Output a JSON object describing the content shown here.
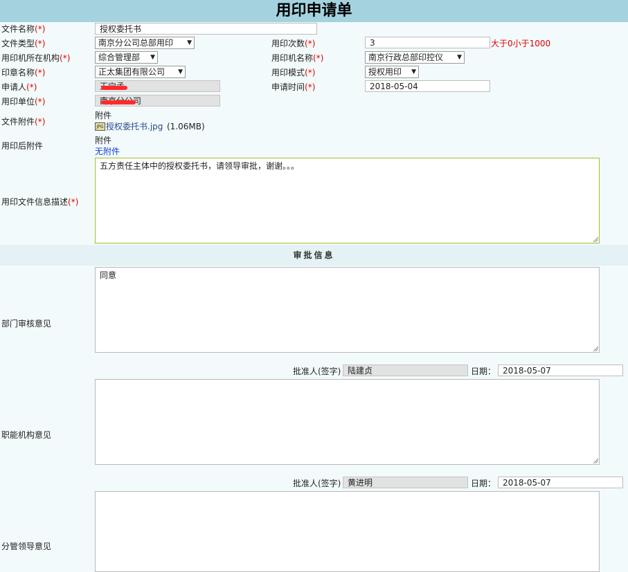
{
  "header": {
    "title": "用印申请单"
  },
  "labels": {
    "file_name": "文件名称",
    "file_type": "文件类型",
    "printer_org": "用印机所在机构",
    "seal_name": "印章名称",
    "applicant": "申请人",
    "unit": "用印单位",
    "attachment": "文件附件",
    "after_attachment": "用印后附件",
    "description": "用印文件信息描述",
    "use_count": "用印次数",
    "printer_name": "用印机名称",
    "mode": "用印模式",
    "apply_time": "申请时间",
    "required": "(*)"
  },
  "form": {
    "file_name_value": "授权委托书",
    "file_type_value": "南京分公司总部用印",
    "use_count_value": "3",
    "use_count_hint": "大于0小于1000",
    "printer_org_value": "综合管理部",
    "printer_name_value": "南京行政总部印控仪",
    "seal_name_value": "正太集团有限公司",
    "mode_value": "授权用印",
    "applicant_value": "王宁孟",
    "apply_time_value": "2018-05-04",
    "unit_value": "南京分公司",
    "attachment_heading": "附件",
    "attachment_file": "授权委托书.jpg",
    "attachment_size": "(1.06MB)",
    "after_heading": "附件",
    "after_none": "无附件",
    "description_value": "五方责任主体中的授权委托书，请领导审批，谢谢。。。",
    "select_arrow": "▼"
  },
  "approval": {
    "section_title": "审批信息",
    "dept_label": "部门审核意见",
    "dept_opinion": "同意",
    "approver_label": "批准人(签字)",
    "date_label": "日期：",
    "dept_approver": "陆建贞",
    "dept_date": "2018-05-07",
    "func_label": "职能机构意见",
    "func_opinion": "",
    "func_approver": "黄进明",
    "func_date": "2018-05-07",
    "leader_label": "分管领导意见",
    "leader_opinion": ""
  },
  "icons": {
    "file": "jpg-file-icon"
  },
  "colors": {
    "header_bg": "#a4d3df",
    "required": "#e00000",
    "link": "#1440d0"
  }
}
